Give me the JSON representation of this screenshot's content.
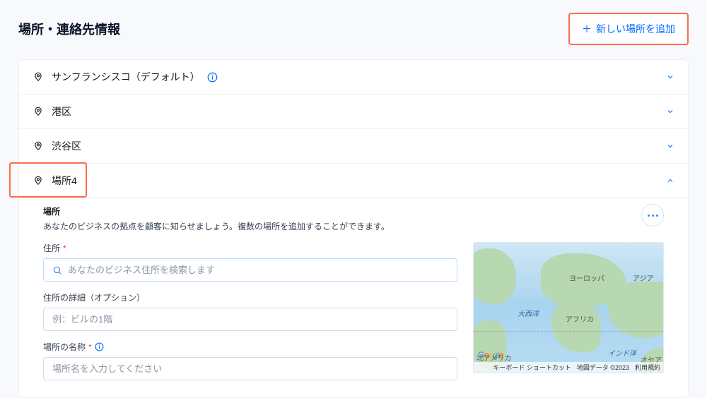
{
  "header": {
    "title": "場所・連絡先情報",
    "add_button_label": "新しい場所を追加"
  },
  "locations": [
    {
      "name": "サンフランシスコ（デフォルト）",
      "default_info": true,
      "expanded": false
    },
    {
      "name": "港区",
      "default_info": false,
      "expanded": false
    },
    {
      "name": "渋谷区",
      "default_info": false,
      "expanded": false
    },
    {
      "name": "場所4",
      "default_info": false,
      "expanded": true
    }
  ],
  "panel": {
    "subtitle": "場所",
    "description": "あなたのビジネスの拠点を顧客に知らせましょう。複数の場所を追加することができます。",
    "fields": {
      "address": {
        "label": "住所",
        "placeholder": "あなたのビジネス住所を検索します"
      },
      "address_detail": {
        "label": "住所の詳細（オプション）",
        "placeholder": "例：ビルの1階"
      },
      "location_name": {
        "label": "場所の名称",
        "placeholder": "場所名を入力してください"
      }
    }
  },
  "map": {
    "seas": {
      "atlantic": "大西洋"
    },
    "regions": {
      "europe": "ヨーロッパ",
      "asia": "アジア",
      "africa": "アフリカ",
      "north_america": "北アメリカ",
      "indian_ocean": "インド洋",
      "oceania": "オセアニア"
    },
    "logo": "Google",
    "attribution": {
      "shortcuts": "キーボード ショートカット",
      "mapdata": "地図データ ©2023",
      "terms": "利用規約"
    }
  }
}
